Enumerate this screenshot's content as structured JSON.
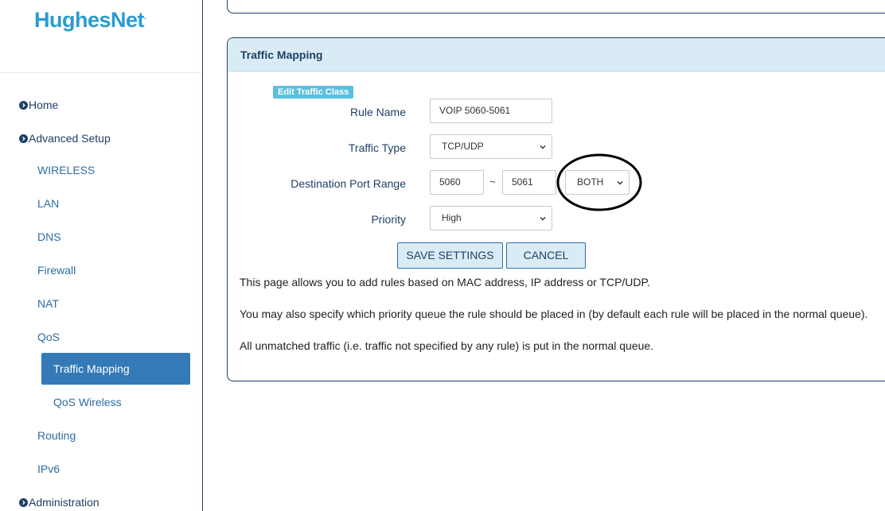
{
  "brand": {
    "name": "HughesNet",
    "mark": "."
  },
  "sidebar": {
    "home": "Home",
    "advanced_setup": "Advanced Setup",
    "items": {
      "wireless": "WIRELESS",
      "lan": "LAN",
      "dns": "DNS",
      "firewall": "Firewall",
      "nat": "NAT",
      "qos": "QoS",
      "traffic_mapping": "Traffic Mapping",
      "qos_wireless": "QoS Wireless",
      "routing": "Routing",
      "ipv6": "IPv6"
    },
    "administration": "Administration"
  },
  "panel": {
    "title": "Traffic Mapping",
    "badge": "Edit Traffic Class",
    "rule_name": {
      "label": "Rule Name",
      "value": "VOIP 5060-5061"
    },
    "traffic_type": {
      "label": "Traffic Type",
      "value": "TCP/UDP"
    },
    "port_range": {
      "label": "Destination Port Range",
      "from": "5060",
      "separator": "~",
      "to": "5061",
      "direction": "BOTH"
    },
    "priority": {
      "label": "Priority",
      "value": "High"
    },
    "buttons": {
      "save": "SAVE SETTINGS",
      "cancel": "CANCEL"
    },
    "descriptions": [
      "This page allows you to add rules based on MAC address, IP address or TCP/UDP.",
      "You may also specify which priority queue the rule should be placed in (by default each rule will be placed in the normal queue).",
      "All unmatched traffic (i.e. traffic not specified by any rule) is put in the normal queue."
    ]
  },
  "colors": {
    "brand_blue": "#2a9bd3",
    "nav_dark": "#1f3f66",
    "active_bg": "#337ab7",
    "panel_head_bg": "#d9ecf5",
    "badge_bg": "#5bc0de"
  }
}
